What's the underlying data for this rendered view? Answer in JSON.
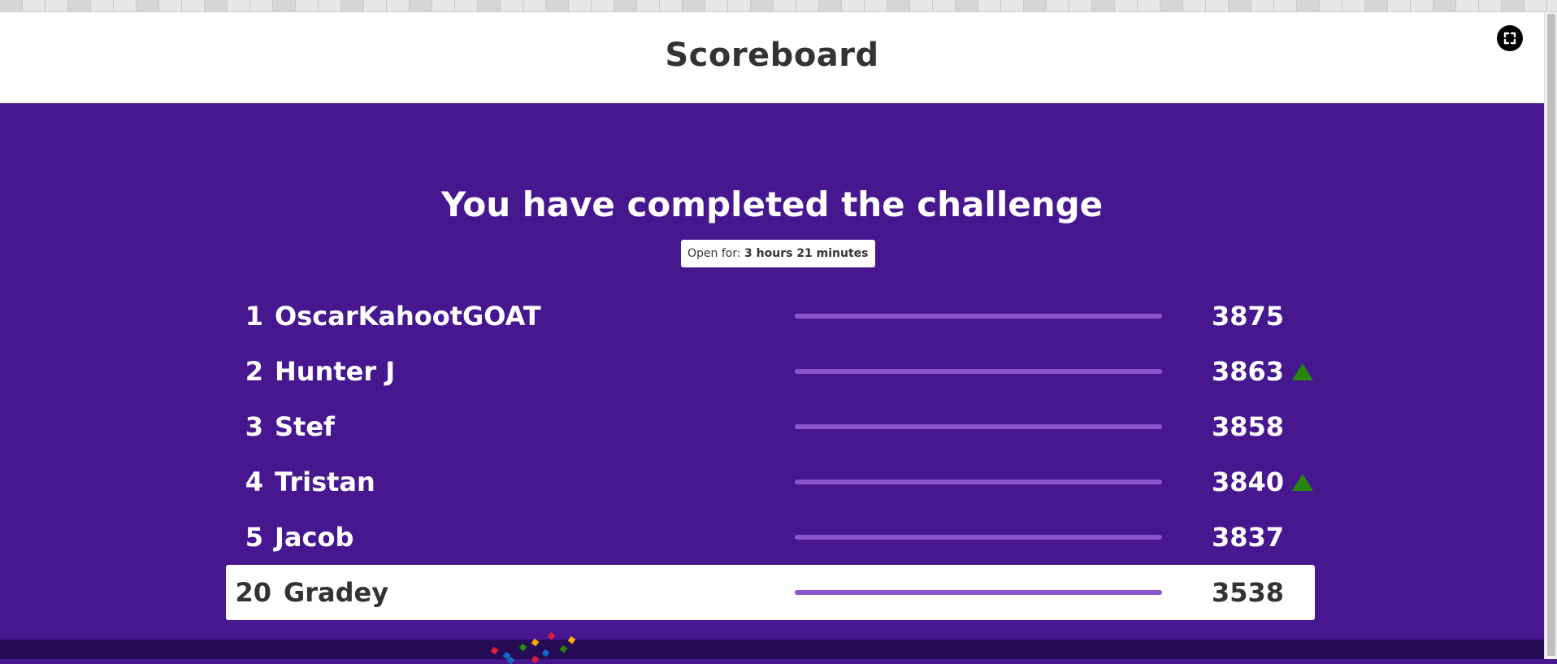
{
  "header": {
    "title": "Scoreboard",
    "fullscreen_icon": "expand-icon"
  },
  "main": {
    "headline": "You have completed the challenge",
    "open_for_label": "Open for:",
    "open_for_value": "3 hours 21 minutes"
  },
  "scoreboard": {
    "rows": [
      {
        "rank": "1",
        "name": "OscarKahootGOAT",
        "score": "3875",
        "progress": 1.0,
        "trend": "none"
      },
      {
        "rank": "2",
        "name": "Hunter J",
        "score": "3863",
        "progress": 1.0,
        "trend": "up"
      },
      {
        "rank": "3",
        "name": "Stef",
        "score": "3858",
        "progress": 1.0,
        "trend": "none"
      },
      {
        "rank": "4",
        "name": "Tristan",
        "score": "3840",
        "progress": 1.0,
        "trend": "up"
      },
      {
        "rank": "5",
        "name": "Jacob",
        "score": "3837",
        "progress": 1.0,
        "trend": "none"
      }
    ],
    "current_player": {
      "rank": "20",
      "name": "Gradey",
      "score": "3538",
      "progress": 1.0,
      "trend": "none"
    }
  },
  "colors": {
    "background": "#46178f",
    "bar": "#8a58cc",
    "up_arrow": "#26890c",
    "footer": "#250c55"
  }
}
